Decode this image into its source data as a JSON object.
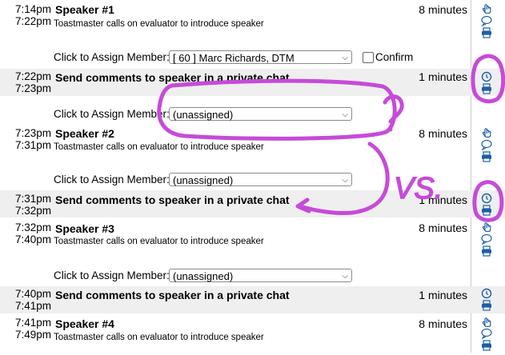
{
  "agenda": [
    {
      "start": "7:14pm",
      "end": "7:22pm",
      "title": "Speaker #1",
      "desc": "Toastmaster calls on evaluator to introduce speaker",
      "duration": "8 minutes"
    },
    {
      "start": "7:22pm",
      "end": "7:23pm",
      "title": "Send comments to speaker in a private chat",
      "duration": "1 minutes"
    },
    {
      "start": "7:23pm",
      "end": "7:31pm",
      "title": "Speaker #2",
      "desc": "Toastmaster calls on evaluator to introduce speaker",
      "duration": "8 minutes"
    },
    {
      "start": "7:31pm",
      "end": "7:32pm",
      "title": "Send comments to speaker in a private chat",
      "duration": "1 minutes"
    },
    {
      "start": "7:32pm",
      "end": "7:40pm",
      "title": "Speaker #3",
      "desc": "Toastmaster calls on evaluator to introduce speaker",
      "duration": "8 minutes"
    },
    {
      "start": "7:40pm",
      "end": "7:41pm",
      "title": "Send comments to speaker in a private chat",
      "duration": "1 minutes"
    },
    {
      "start": "7:41pm",
      "end": "7:49pm",
      "title": "Speaker #4",
      "desc": "Toastmaster calls on evaluator to introduce speaker",
      "duration": "8 minutes"
    }
  ],
  "assign": {
    "label": "Click to Assign Member:",
    "value_1": "[ 60 ] Marc Richards, DTM",
    "value_unassigned": "(unassigned)",
    "confirm": "Confirm"
  },
  "annotation": {
    "question": "?",
    "vs": "VS."
  },
  "colors": {
    "annotation": "#c64bd9",
    "icon_blue": "#1d5fa8"
  },
  "icons": [
    "hand-pointer-icon",
    "speech-bubble-icon",
    "printer-icon",
    "clock-icon"
  ]
}
